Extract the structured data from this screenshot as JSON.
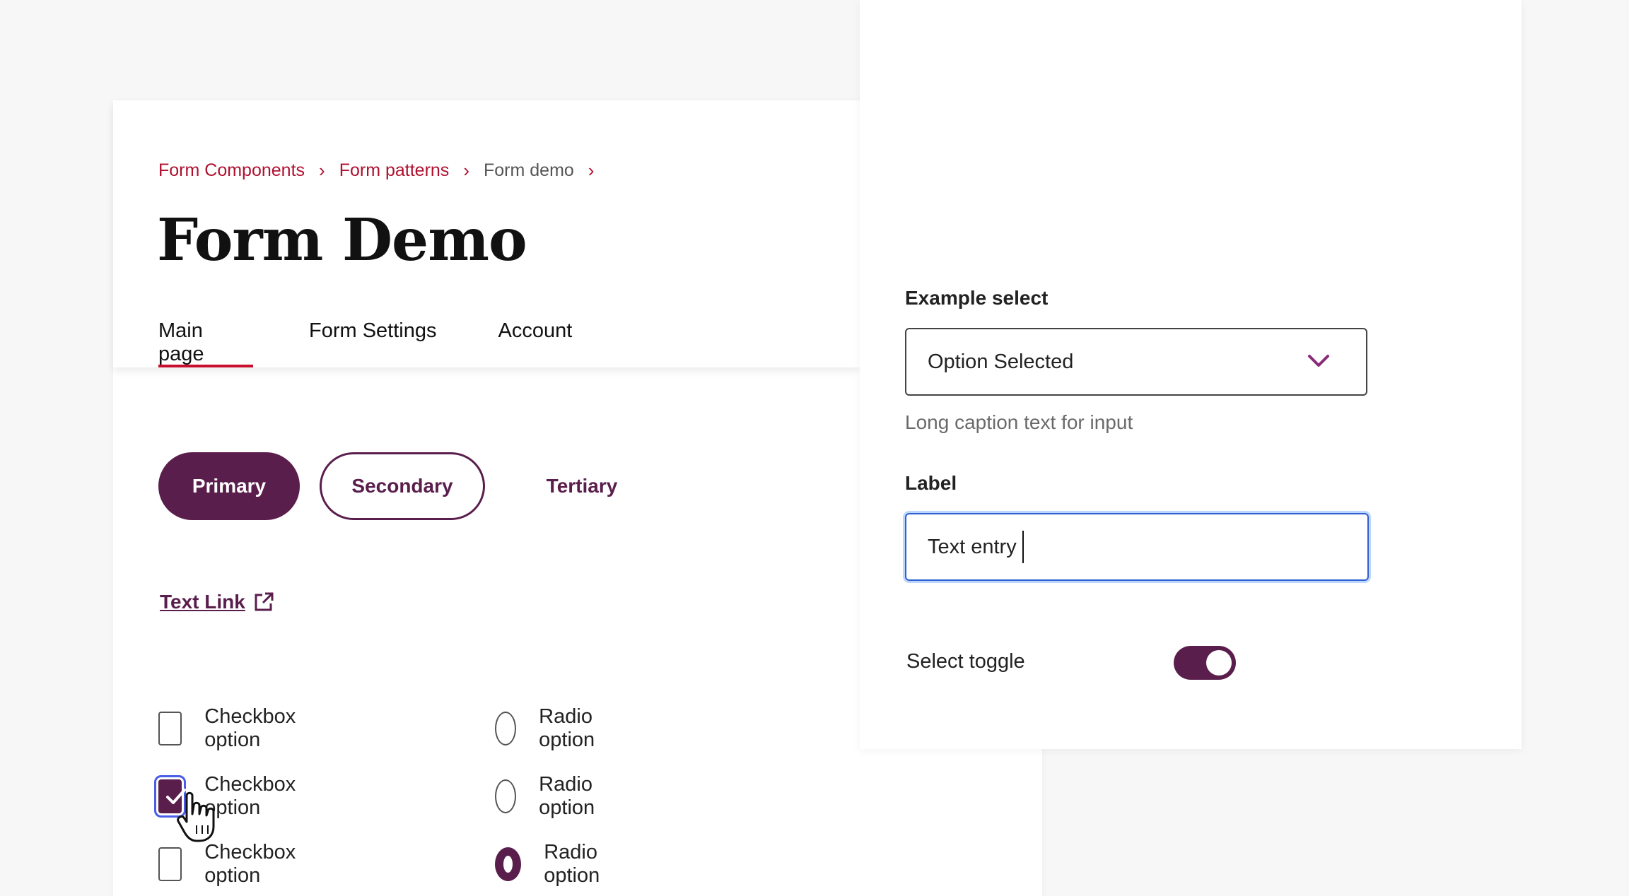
{
  "breadcrumb": {
    "items": [
      "Form Components",
      "Form patterns",
      "Form demo"
    ],
    "separator": "›"
  },
  "page_title": "Form Demo",
  "tabs": [
    {
      "label": "Main page",
      "active": true
    },
    {
      "label": "Form Settings",
      "active": false
    },
    {
      "label": "Account",
      "active": false
    }
  ],
  "buttons": {
    "primary": "Primary",
    "secondary": "Secondary",
    "tertiary": "Tertiary"
  },
  "text_link": {
    "label": "Text Link",
    "icon": "external-link-icon"
  },
  "checkboxes": [
    {
      "label": "Checkbox option",
      "checked": false
    },
    {
      "label": "Checkbox option",
      "checked": true
    },
    {
      "label": "Checkbox option",
      "checked": false
    }
  ],
  "radios": [
    {
      "label": "Radio option",
      "checked": false
    },
    {
      "label": "Radio option",
      "checked": false
    },
    {
      "label": "Radio option",
      "checked": true
    }
  ],
  "select": {
    "label": "Example select",
    "value": "Option Selected",
    "caption": "Long caption text for input",
    "icon": "chevron-down-icon"
  },
  "text_field": {
    "label": "Label",
    "value": "Text entry"
  },
  "toggle": {
    "label": "Select toggle",
    "on": true
  },
  "colors": {
    "brand": "#5a1e4c",
    "link_red": "#b0102f",
    "tab_underline": "#c8102e",
    "focus_blue": "#2f5fd0"
  }
}
